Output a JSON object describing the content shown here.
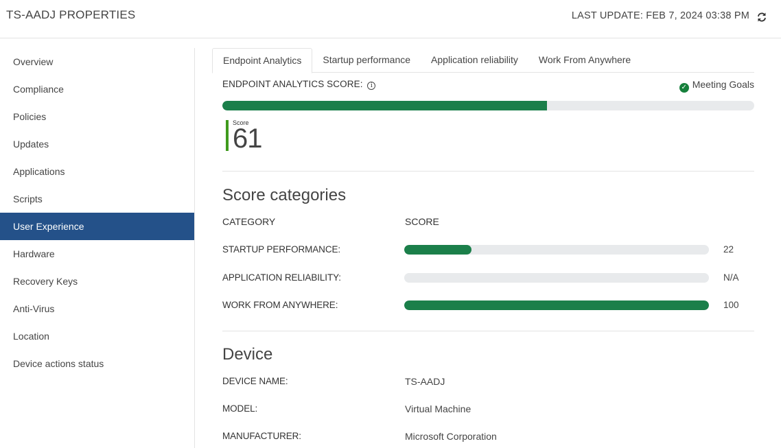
{
  "header": {
    "title": "TS-AADJ PROPERTIES",
    "last_update": "LAST UPDATE: FEB 7, 2024 03:38 PM",
    "refresh_icon": "refresh-icon"
  },
  "sidebar": {
    "items": [
      {
        "label": "Overview"
      },
      {
        "label": "Compliance"
      },
      {
        "label": "Policies"
      },
      {
        "label": "Updates"
      },
      {
        "label": "Applications"
      },
      {
        "label": "Scripts"
      },
      {
        "label": "User Experience",
        "active": true
      },
      {
        "label": "Hardware"
      },
      {
        "label": "Recovery Keys"
      },
      {
        "label": "Anti-Virus"
      },
      {
        "label": "Location"
      },
      {
        "label": "Device actions status"
      }
    ],
    "active_color": "#245189"
  },
  "tabs": [
    {
      "label": "Endpoint Analytics",
      "active": true
    },
    {
      "label": "Startup performance"
    },
    {
      "label": "Application reliability"
    },
    {
      "label": "Work From Anywhere"
    }
  ],
  "analytics": {
    "score_label": "ENDPOINT ANALYTICS SCORE:",
    "info_icon": "info-icon",
    "goal_status": "Meeting Goals",
    "goal_icon": "check-circle-icon",
    "score_caption": "Score",
    "score_value": "61",
    "score_fraction": 0.61,
    "bar_color": "#1b7f4a",
    "accent_color": "#3f9a1d"
  },
  "categories": {
    "title": "Score categories",
    "col_category": "CATEGORY",
    "col_score": "SCORE",
    "rows": [
      {
        "name": "STARTUP PERFORMANCE:",
        "value": "22",
        "fraction": 0.22
      },
      {
        "name": "APPLICATION RELIABILITY:",
        "value": "N/A",
        "fraction": 0
      },
      {
        "name": "WORK FROM ANYWHERE:",
        "value": "100",
        "fraction": 1.0
      }
    ]
  },
  "device": {
    "title": "Device",
    "rows": [
      {
        "key": "DEVICE NAME:",
        "value": "TS-AADJ"
      },
      {
        "key": "MODEL:",
        "value": "Virtual Machine"
      },
      {
        "key": "MANUFACTURER:",
        "value": "Microsoft Corporation"
      }
    ]
  }
}
